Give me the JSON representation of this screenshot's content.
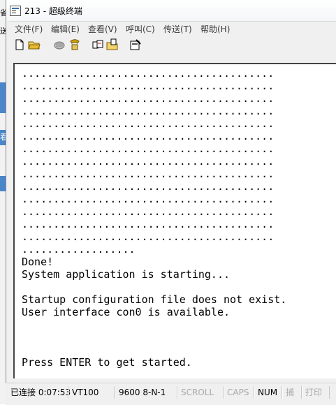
{
  "window": {
    "title": "213 - 超级终端"
  },
  "background_app": {
    "frag1": "省",
    "frag2": "送",
    "frag3": "看"
  },
  "menu": {
    "items": [
      "文件(F)",
      "编辑(E)",
      "查看(V)",
      "呼叫(C)",
      "传送(T)",
      "帮助(H)"
    ]
  },
  "toolbar": {
    "icons": [
      "new-document-icon",
      "open-folder-icon",
      "disconnect-icon",
      "connect-phone-icon",
      "send-file-icon",
      "receive-file-icon",
      "properties-icon"
    ]
  },
  "terminal": {
    "lines": [
      "........................................",
      "........................................",
      "........................................",
      "........................................",
      "........................................",
      "........................................",
      "........................................",
      "........................................",
      "........................................",
      "........................................",
      "........................................",
      "........................................",
      "........................................",
      "........................................",
      "..................",
      "Done!",
      "System application is starting...",
      "",
      "Startup configuration file does not exist.",
      "User interface con0 is available.",
      "",
      "",
      "",
      "Press ENTER to get started."
    ]
  },
  "status": {
    "connection": "已连接 0:07:53",
    "emulation": "VT100",
    "port_settings": "9600 8-N-1",
    "scroll": "SCROLL",
    "caps": "CAPS",
    "num": "NUM",
    "capture": "捕",
    "print": "打印"
  }
}
